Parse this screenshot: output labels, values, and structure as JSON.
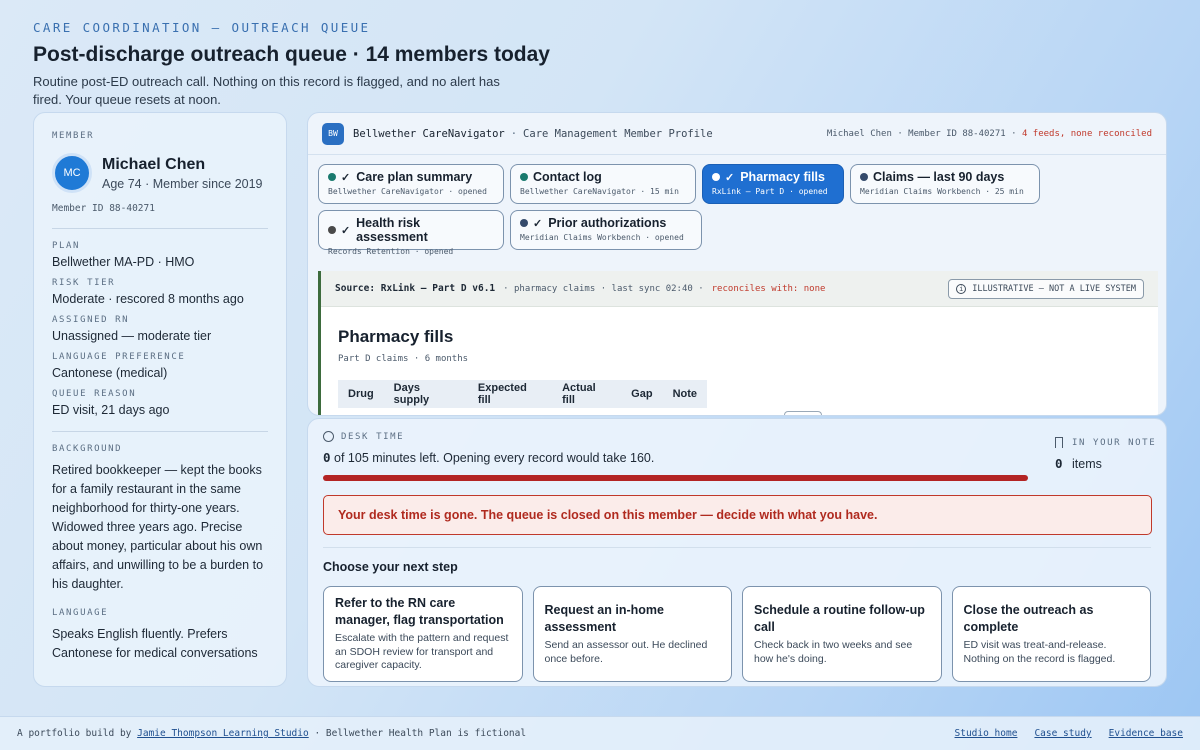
{
  "header": {
    "eyebrow": "CARE COORDINATION — OUTREACH QUEUE",
    "title": "Post-discharge outreach queue · 14 members today",
    "subtitle": "Routine post-ED outreach call. Nothing on this record is flagged, and no alert has fired. Your queue resets at noon."
  },
  "member": {
    "section_label": "MEMBER",
    "initials": "MC",
    "name": "Michael Chen",
    "age_line": "Age 74 · Member since 2019",
    "member_id": "Member ID 88-40271",
    "fields": [
      {
        "label": "PLAN",
        "value": "Bellwether MA-PD · HMO"
      },
      {
        "label": "RISK TIER",
        "value": "Moderate · rescored 8 months ago"
      },
      {
        "label": "ASSIGNED RN",
        "value": "Unassigned — moderate tier"
      },
      {
        "label": "LANGUAGE PREFERENCE",
        "value": "Cantonese (medical)"
      },
      {
        "label": "QUEUE REASON",
        "value": "ED visit, 21 days ago"
      }
    ],
    "background_label": "BACKGROUND",
    "background_text": "Retired bookkeeper — kept the books for a family restaurant in the same neighborhood for thirty-one years. Widowed three years ago. Precise about money, particular about his own affairs, and unwilling to be a burden to his daughter.",
    "language_label": "LANGUAGE",
    "language_text": "Speaks English fluently. Prefers Cantonese for medical conversations"
  },
  "profile": {
    "badge": "BW",
    "app_name": "Bellwether CareNavigator",
    "separator": "·",
    "app_sub": "Care Management Member Profile",
    "head_right": "Michael Chen · Member ID 88-40271 ·",
    "head_warn": "4 feeds, none reconciled",
    "tabs": [
      {
        "title": "Care plan summary",
        "meta": "Bellwether CareNavigator · opened",
        "dot": "#1a7a6e"
      },
      {
        "title": "Contact log",
        "meta": "Bellwether CareNavigator · 15 min",
        "dot": "#1a7a6e"
      },
      {
        "title": "Pharmacy fills",
        "meta": "RxLink — Part D · opened",
        "dot": "#ffffff"
      },
      {
        "title": "Claims — last 90 days",
        "meta": "Meridian Claims Workbench · 25 min",
        "dot": "#344a6b"
      },
      {
        "title": "Health risk assessment",
        "meta": "Records Retention · opened",
        "dot": "#4a4a4a"
      },
      {
        "title": "Prior authorizations",
        "meta": "Meridian Claims Workbench · opened",
        "dot": "#344a6b"
      }
    ],
    "check": "✓",
    "source": {
      "title": "Source: RxLink — Part D v6.1",
      "meta": "· pharmacy claims · last sync 02:40 ·",
      "warn": "reconciles with: none",
      "illustrative": "ILLUSTRATIVE — NOT A LIVE SYSTEM",
      "heading": "Pharmacy fills",
      "subheading": "Part D claims · 6 months",
      "columns": [
        "Drug",
        "Days supply",
        "Expected fill",
        "Actual fill",
        "Gap",
        "Note"
      ]
    }
  },
  "desk": {
    "label": "DESK TIME",
    "remaining": "0",
    "line_rest": "of 105 minutes left. Opening every record would take 160.",
    "progress_remaining_fraction": 0,
    "note_label": "IN YOUR NOTE",
    "note_count": "0",
    "note_unit": "items",
    "alert": "Your desk time is gone. The queue is closed on this member — decide with what you have.",
    "choose_label": "Choose your next step",
    "choices": [
      {
        "title": "Refer to the RN care manager, flag transportation",
        "desc": "Escalate with the pattern and request an SDOH review for transport and caregiver capacity."
      },
      {
        "title": "Request an in-home assessment",
        "desc": "Send an assessor out. He declined once before."
      },
      {
        "title": "Schedule a routine follow-up call",
        "desc": "Check back in two weeks and see how he's doing."
      },
      {
        "title": "Close the outreach as complete",
        "desc": "ED visit was treat-and-release. Nothing on the record is flagged."
      }
    ]
  },
  "footer": {
    "prefix": "A portfolio build by",
    "studio_link": "Jamie Thompson Learning Studio",
    "suffix": "· Bellwether Health Plan is fictional",
    "links": [
      "Studio home",
      "Case study",
      "Evidence base"
    ]
  }
}
